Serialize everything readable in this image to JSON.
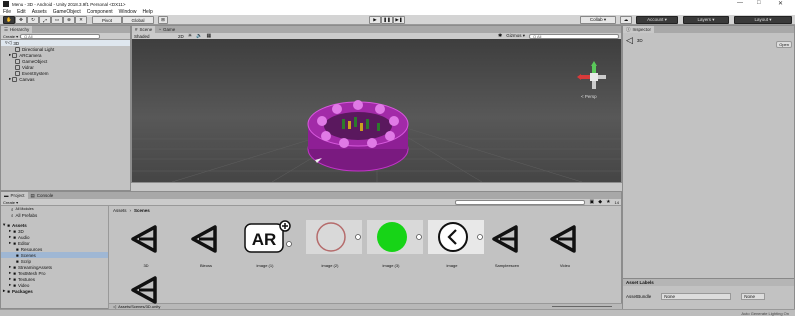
{
  "window": {
    "title": "Menu - 3D - Android - Unity 2018.3.9f1 Personal <DX11>",
    "min": "—",
    "max": "□",
    "close": "✕"
  },
  "menu": [
    "File",
    "Edit",
    "Assets",
    "GameObject",
    "Component",
    "Window",
    "Help"
  ],
  "toolbar": {
    "pivot": "Pivot",
    "global": "Global",
    "collab": "Collab ▾",
    "account": "Account ▾",
    "layers": "Layers ▾",
    "layout": "Layout ▾",
    "play": "▶",
    "pause": "❚❚",
    "step": "▶❚"
  },
  "hierarchy": {
    "tab": "Hierarchy",
    "create": "Create ▾",
    "search": "Q All",
    "scene": "3D",
    "items": [
      "Directional Light",
      "ARCamera",
      "GameObject",
      "Vidrar",
      "EventSystem",
      "Canvas"
    ]
  },
  "scene_view": {
    "tabs": [
      "Scene",
      "Game"
    ],
    "shading": "Shaded",
    "mode": "2D",
    "gizmos": "Gizmos ▾",
    "search": "Q All",
    "persp": "< Persp"
  },
  "project": {
    "tabs": [
      "Project",
      "Console"
    ],
    "create": "Create ▾",
    "fav_items": [
      "All Modules",
      "All Prefabs"
    ],
    "tree": [
      "Assets",
      "3D",
      "Audio",
      "Editor",
      "Resources",
      "Scenes",
      "Scrip",
      "StreamingAssets",
      "TextMesh Pro",
      "Textures",
      "Video",
      "Packages"
    ],
    "breadcrumb": [
      "Assets",
      "Scenes"
    ],
    "assets": [
      {
        "name": "3D",
        "icon": "unity-icon"
      },
      {
        "name": "Bleoss",
        "icon": "unity-icon"
      },
      {
        "name": "image (1)",
        "icon": "ar-icon"
      },
      {
        "name": "image (2)",
        "icon": "ring-icon"
      },
      {
        "name": "image (3)",
        "icon": "green-circle-icon"
      },
      {
        "name": "image",
        "icon": "back-arrow-icon"
      },
      {
        "name": "Sampleescen",
        "icon": "unity-icon"
      },
      {
        "name": "Video",
        "icon": "unity-icon"
      },
      {
        "name": "",
        "icon": "unity-icon"
      }
    ],
    "path": "Assets/Scenes/3D.unity",
    "count": "14"
  },
  "inspector": {
    "tab": "Inspector",
    "object": "3D",
    "open": "Open",
    "labels": "Asset Labels",
    "bundle": "AssetBundle",
    "none1": "None",
    "none2": "None"
  },
  "status": "Auto Generate Lighting On",
  "colors": {
    "ring": "#a21fa8",
    "green": "#17d417",
    "scene_bg": "#4a4a4a"
  }
}
